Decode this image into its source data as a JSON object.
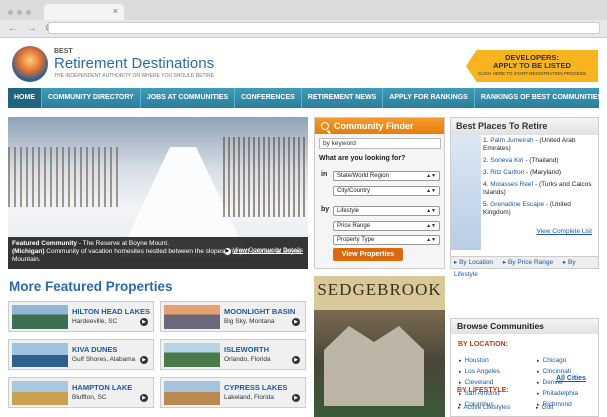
{
  "browser": {
    "tab_close": "×",
    "back": "←",
    "forward": "→",
    "reload": "C"
  },
  "logo": {
    "small": "BEST",
    "title": "Retirement Destinations",
    "tagline": "THE INDEPENDENT AUTHORITY ON WHERE YOU SHOULD RETIRE"
  },
  "dev_banner": {
    "line1": "DEVELOPERS:",
    "line2": "APPLY TO BE LISTED",
    "line3": "CLICK HERE TO START REGISTRATION PROCESS"
  },
  "nav": [
    "HOME",
    "COMMUNITY DIRECTORY",
    "JOBS AT COMMUNITIES",
    "CONFERENCES",
    "RETIREMENT NEWS",
    "APPLY FOR RANKINGS",
    "RANKINGS OF BEST COMMUNITIES"
  ],
  "hero": {
    "featured_label": "Featured Community",
    "featured_text": " - The Reserve at Boyne Mount.",
    "state": "(Michigan)",
    "description": " Community of vacation homesites nestled between the slopes and golf courses at Boyne Mountain.",
    "link": "View Community Details"
  },
  "finder": {
    "title": "Community Finder",
    "keyword_placeholder": "by keyword",
    "question": "What are you looking for?",
    "in_label": "in",
    "by_label": "by",
    "selects": [
      "State/World Region",
      "City/Country",
      "Lifestyle",
      "Price Range",
      "Property Type"
    ],
    "button": "View Properties"
  },
  "best": {
    "title": "Best Places To Retire",
    "items": [
      {
        "n": "1.",
        "name": "Palm Jumeirah",
        "place": " - (United Arab Emirates)"
      },
      {
        "n": "2.",
        "name": "Soneva Kiri",
        "place": " - (Thailand)"
      },
      {
        "n": "3.",
        "name": "Ritz Carlton",
        "place": " - (Maryland)"
      },
      {
        "n": "4.",
        "name": "Molasses Reef",
        "place": " - (Turks and Caicos Islands)"
      },
      {
        "n": "5.",
        "name": "Grenadine Escape",
        "place": " - (United Kingdom)"
      }
    ],
    "more": "View Complete List",
    "footer": [
      "By Location",
      "By Price Range",
      "By Lifestyle"
    ]
  },
  "featured": {
    "title": "More Featured Properties",
    "properties": [
      {
        "name": "HILTON HEAD LAKES",
        "loc": "Hardeeville, SC"
      },
      {
        "name": "MOONLIGHT BASIN",
        "loc": "Big Sky, Montana"
      },
      {
        "name": "KIVA DUNES",
        "loc": "Gulf Shores, Alabama"
      },
      {
        "name": "ISLEWORTH",
        "loc": "Orlando, Florida"
      },
      {
        "name": "HAMPTON LAKE",
        "loc": "Bluffton, SC"
      },
      {
        "name": "CYPRESS LAKES",
        "loc": "Lakeland, Florida"
      }
    ]
  },
  "ad": {
    "title": "SEDGEBROOK"
  },
  "browse": {
    "title": "Browse Communities",
    "by_location": "BY LOCATION:",
    "cities": [
      "Houston",
      "Chicago",
      "Los Angeles",
      "Cincinnati",
      "Cleveland",
      "Denver",
      "San Antonio",
      "Philadelphia",
      "Columbus",
      "Richmond"
    ],
    "all": "All Cities",
    "by_lifestyle": "BY LIFESTYLE:",
    "lifestyles": [
      "Active Lifestyles",
      "Golf"
    ]
  }
}
